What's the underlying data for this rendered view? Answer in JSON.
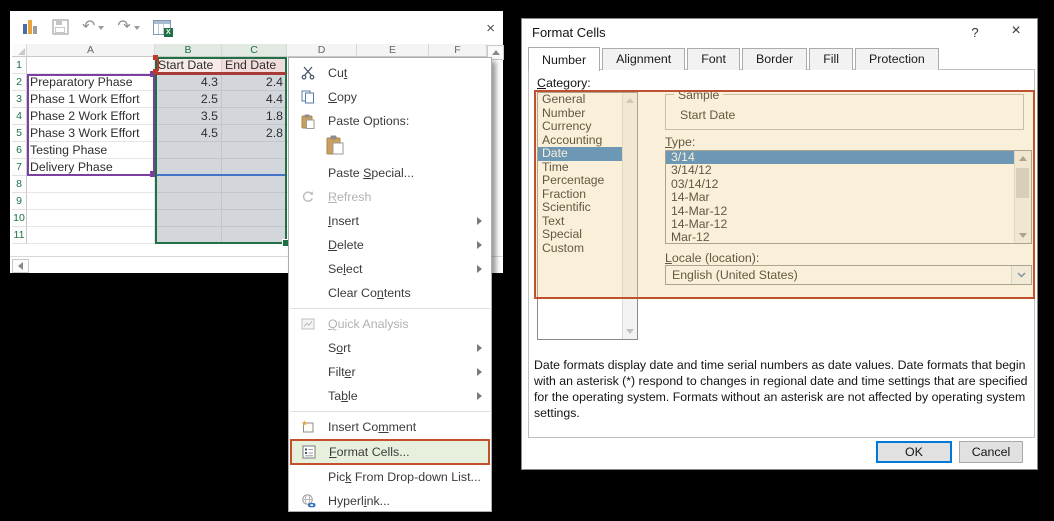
{
  "colors": {
    "excel_green": "#1e7145",
    "selection_fill": "#d3d7dc",
    "selection_blue": "#2578c9",
    "annotation_red": "#c0512f",
    "annotation_green_fill": "#e7f0dc",
    "range_purple": "#7b3fa0",
    "range_red": "#a63c35",
    "range_blue": "#4472c4",
    "header_pink": "#f0dcda",
    "cream_overlay": "#faf0da"
  },
  "excel": {
    "toolbar_icons": [
      "column-chart-icon",
      "save-icon",
      "undo-icon",
      "redo-icon",
      "excel-table-icon"
    ],
    "close_label": "×",
    "columns": [
      "A",
      "B",
      "C",
      "D",
      "E",
      "F"
    ],
    "selected_columns": [
      "B",
      "C"
    ],
    "rows": [
      {
        "n": "1",
        "a": "",
        "b": "Start Date",
        "c": "End Date"
      },
      {
        "n": "2",
        "a": "Preparatory Phase",
        "b": "4.3",
        "c": "2.4"
      },
      {
        "n": "3",
        "a": "Phase 1 Work Effort",
        "b": "2.5",
        "c": "4.4"
      },
      {
        "n": "4",
        "a": "Phase 2 Work Effort",
        "b": "3.5",
        "c": "1.8"
      },
      {
        "n": "5",
        "a": "Phase 3 Work Effort",
        "b": "4.5",
        "c": "2.8"
      },
      {
        "n": "6",
        "a": "Testing Phase",
        "b": "",
        "c": ""
      },
      {
        "n": "7",
        "a": "Delivery Phase",
        "b": "",
        "c": ""
      },
      {
        "n": "8",
        "a": "",
        "b": "",
        "c": ""
      },
      {
        "n": "9",
        "a": "",
        "b": "",
        "c": ""
      },
      {
        "n": "10",
        "a": "",
        "b": "",
        "c": ""
      },
      {
        "n": "11",
        "a": "",
        "b": "",
        "c": ""
      }
    ]
  },
  "context_menu": {
    "items": [
      {
        "type": "item",
        "icon": "scissors",
        "label": "Cut",
        "accel": 2
      },
      {
        "type": "item",
        "icon": "copy",
        "label": "Copy",
        "accel": 0
      },
      {
        "type": "item",
        "icon": "clipboard",
        "label": "Paste Options:",
        "accel": -1
      },
      {
        "type": "paste-preview",
        "icon": "clipboard-large"
      },
      {
        "type": "item",
        "label": "Paste Special...",
        "accel": 6
      },
      {
        "type": "item",
        "icon": "refresh",
        "label": "Refresh",
        "accel": 0,
        "disabled": true
      },
      {
        "type": "item",
        "label": "Insert",
        "accel": 0,
        "submenu": true
      },
      {
        "type": "item",
        "label": "Delete",
        "accel": 0,
        "submenu": true
      },
      {
        "type": "item",
        "label": "Select",
        "accel": 2,
        "submenu": true
      },
      {
        "type": "item",
        "label": "Clear Contents",
        "accel": 8
      },
      {
        "type": "separator"
      },
      {
        "type": "item",
        "icon": "quick-analysis",
        "label": "Quick Analysis",
        "accel": 0,
        "disabled": true
      },
      {
        "type": "item",
        "label": "Sort",
        "accel": 1,
        "submenu": true
      },
      {
        "type": "item",
        "label": "Filter",
        "accel": 4,
        "submenu": true
      },
      {
        "type": "item",
        "label": "Table",
        "accel": 2,
        "submenu": true
      },
      {
        "type": "separator"
      },
      {
        "type": "item",
        "icon": "comment",
        "label": "Insert Comment",
        "accel": 9
      },
      {
        "type": "item",
        "icon": "format-cells",
        "label": "Format Cells...",
        "accel": 0,
        "highlighted": true
      },
      {
        "type": "item",
        "label": "Pick From Drop-down List...",
        "accel": 3
      },
      {
        "type": "item",
        "icon": "hyperlink",
        "label": "Hyperlink...",
        "accel": 6
      }
    ]
  },
  "dialog": {
    "title": "Format Cells",
    "help_label": "?",
    "close_label": "×",
    "tabs": [
      "Number",
      "Alignment",
      "Font",
      "Border",
      "Fill",
      "Protection"
    ],
    "active_tab": "Number",
    "category_label": {
      "text": "Category:",
      "accel": 0
    },
    "categories": [
      "General",
      "Number",
      "Currency",
      "Accounting",
      "Date",
      "Time",
      "Percentage",
      "Fraction",
      "Scientific",
      "Text",
      "Special",
      "Custom"
    ],
    "selected_category": "Date",
    "sample_label": "Sample",
    "sample_value": "Start Date",
    "type_label": {
      "text": "Type:",
      "accel": 0
    },
    "types": [
      "3/14",
      "3/14/12",
      "03/14/12",
      "14-Mar",
      "14-Mar-12",
      "14-Mar-12",
      "Mar-12"
    ],
    "selected_type_index": 0,
    "locale_label": {
      "text": "Locale (location):",
      "accel": 0
    },
    "locale_value": "English (United States)",
    "description": "Date formats display date and time serial numbers as date values.  Date formats that begin with an asterisk (*) respond to changes in regional date and time settings that are specified for the operating system. Formats without an asterisk are not affected by operating system settings.",
    "ok_label": "OK",
    "cancel_label": "Cancel"
  }
}
